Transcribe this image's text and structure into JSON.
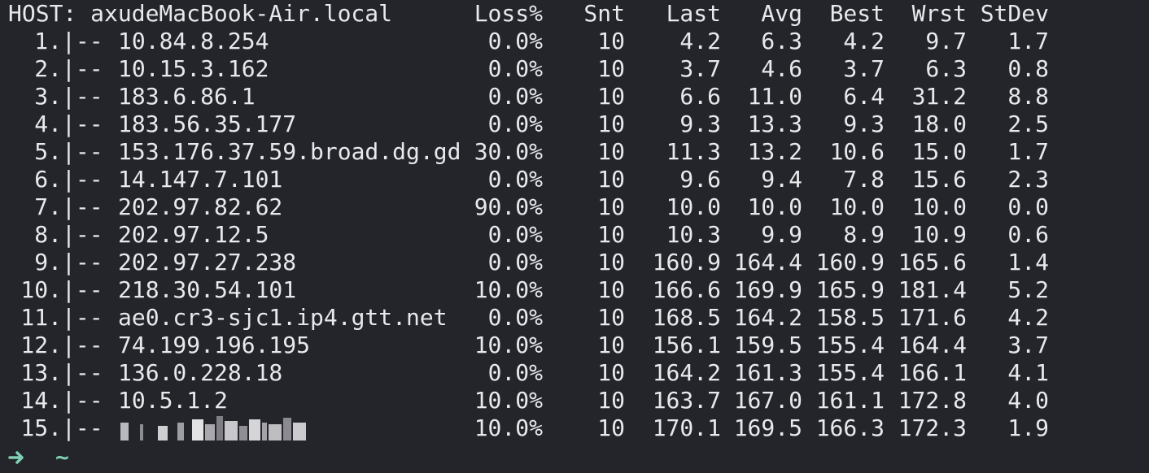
{
  "header": {
    "host_label": "HOST: axudeMacBook-Air.local",
    "columns": [
      "Loss%",
      "Snt",
      "Last",
      "Avg",
      "Best",
      "Wrst",
      "StDev"
    ]
  },
  "hop_separator": "|--",
  "hops": [
    {
      "num": "1.",
      "host": "10.84.8.254",
      "loss": "0.0%",
      "snt": "10",
      "last": "4.2",
      "avg": "6.3",
      "best": "4.2",
      "wrst": "9.7",
      "stdev": "1.7"
    },
    {
      "num": "2.",
      "host": "10.15.3.162",
      "loss": "0.0%",
      "snt": "10",
      "last": "3.7",
      "avg": "4.6",
      "best": "3.7",
      "wrst": "6.3",
      "stdev": "0.8"
    },
    {
      "num": "3.",
      "host": "183.6.86.1",
      "loss": "0.0%",
      "snt": "10",
      "last": "6.6",
      "avg": "11.0",
      "best": "6.4",
      "wrst": "31.2",
      "stdev": "8.8"
    },
    {
      "num": "4.",
      "host": "183.56.35.177",
      "loss": "0.0%",
      "snt": "10",
      "last": "9.3",
      "avg": "13.3",
      "best": "9.3",
      "wrst": "18.0",
      "stdev": "2.5"
    },
    {
      "num": "5.",
      "host": "153.176.37.59.broad.dg.gd",
      "loss": "30.0%",
      "snt": "10",
      "last": "11.3",
      "avg": "13.2",
      "best": "10.6",
      "wrst": "15.0",
      "stdev": "1.7"
    },
    {
      "num": "6.",
      "host": "14.147.7.101",
      "loss": "0.0%",
      "snt": "10",
      "last": "9.6",
      "avg": "9.4",
      "best": "7.8",
      "wrst": "15.6",
      "stdev": "2.3"
    },
    {
      "num": "7.",
      "host": "202.97.82.62",
      "loss": "90.0%",
      "snt": "10",
      "last": "10.0",
      "avg": "10.0",
      "best": "10.0",
      "wrst": "10.0",
      "stdev": "0.0"
    },
    {
      "num": "8.",
      "host": "202.97.12.5",
      "loss": "0.0%",
      "snt": "10",
      "last": "10.3",
      "avg": "9.9",
      "best": "8.9",
      "wrst": "10.9",
      "stdev": "0.6"
    },
    {
      "num": "9.",
      "host": "202.97.27.238",
      "loss": "0.0%",
      "snt": "10",
      "last": "160.9",
      "avg": "164.4",
      "best": "160.9",
      "wrst": "165.6",
      "stdev": "1.4"
    },
    {
      "num": "10.",
      "host": "218.30.54.101",
      "loss": "10.0%",
      "snt": "10",
      "last": "166.6",
      "avg": "169.9",
      "best": "165.9",
      "wrst": "181.4",
      "stdev": "5.2"
    },
    {
      "num": "11.",
      "host": "ae0.cr3-sjc1.ip4.gtt.net",
      "loss": "0.0%",
      "snt": "10",
      "last": "168.5",
      "avg": "164.2",
      "best": "158.5",
      "wrst": "171.6",
      "stdev": "4.2"
    },
    {
      "num": "12.",
      "host": "74.199.196.195",
      "loss": "10.0%",
      "snt": "10",
      "last": "156.1",
      "avg": "159.5",
      "best": "155.4",
      "wrst": "164.4",
      "stdev": "3.7"
    },
    {
      "num": "13.",
      "host": "136.0.228.18",
      "loss": "0.0%",
      "snt": "10",
      "last": "164.2",
      "avg": "161.3",
      "best": "155.4",
      "wrst": "166.1",
      "stdev": "4.1"
    },
    {
      "num": "14.",
      "host": "10.5.1.2",
      "loss": "10.0%",
      "snt": "10",
      "last": "163.7",
      "avg": "167.0",
      "best": "161.1",
      "wrst": "172.8",
      "stdev": "4.0"
    },
    {
      "num": "15.",
      "host": "",
      "loss": "10.0%",
      "snt": "10",
      "last": "170.1",
      "avg": "169.5",
      "best": "166.3",
      "wrst": "172.3",
      "stdev": "1.9",
      "host_masked": true
    }
  ],
  "prompt": {
    "arrow_icon": "arrow-right-icon",
    "cwd": "~",
    "arrow_color": "#7fd0b3"
  },
  "colors": {
    "background": "#24252b",
    "foreground": "#e9e9ec"
  }
}
